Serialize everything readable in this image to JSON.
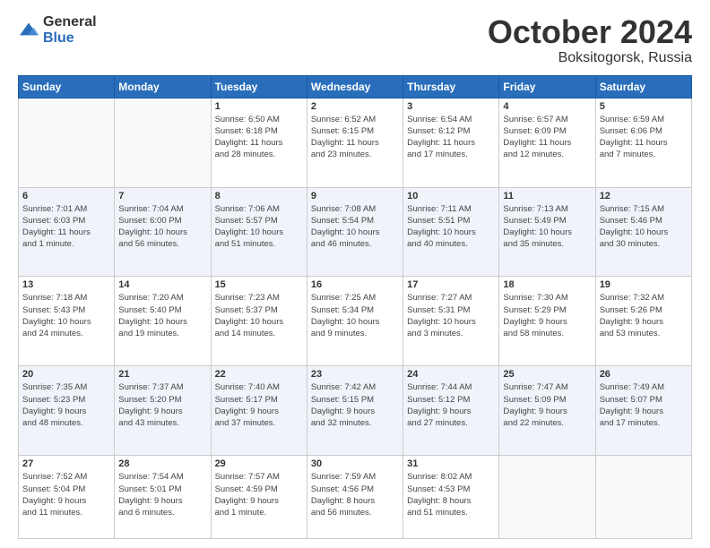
{
  "header": {
    "logo_general": "General",
    "logo_blue": "Blue",
    "month": "October 2024",
    "location": "Boksitogorsk, Russia"
  },
  "weekdays": [
    "Sunday",
    "Monday",
    "Tuesday",
    "Wednesday",
    "Thursday",
    "Friday",
    "Saturday"
  ],
  "weeks": [
    [
      {
        "day": "",
        "info": ""
      },
      {
        "day": "",
        "info": ""
      },
      {
        "day": "1",
        "info": "Sunrise: 6:50 AM\nSunset: 6:18 PM\nDaylight: 11 hours\nand 28 minutes."
      },
      {
        "day": "2",
        "info": "Sunrise: 6:52 AM\nSunset: 6:15 PM\nDaylight: 11 hours\nand 23 minutes."
      },
      {
        "day": "3",
        "info": "Sunrise: 6:54 AM\nSunset: 6:12 PM\nDaylight: 11 hours\nand 17 minutes."
      },
      {
        "day": "4",
        "info": "Sunrise: 6:57 AM\nSunset: 6:09 PM\nDaylight: 11 hours\nand 12 minutes."
      },
      {
        "day": "5",
        "info": "Sunrise: 6:59 AM\nSunset: 6:06 PM\nDaylight: 11 hours\nand 7 minutes."
      }
    ],
    [
      {
        "day": "6",
        "info": "Sunrise: 7:01 AM\nSunset: 6:03 PM\nDaylight: 11 hours\nand 1 minute."
      },
      {
        "day": "7",
        "info": "Sunrise: 7:04 AM\nSunset: 6:00 PM\nDaylight: 10 hours\nand 56 minutes."
      },
      {
        "day": "8",
        "info": "Sunrise: 7:06 AM\nSunset: 5:57 PM\nDaylight: 10 hours\nand 51 minutes."
      },
      {
        "day": "9",
        "info": "Sunrise: 7:08 AM\nSunset: 5:54 PM\nDaylight: 10 hours\nand 46 minutes."
      },
      {
        "day": "10",
        "info": "Sunrise: 7:11 AM\nSunset: 5:51 PM\nDaylight: 10 hours\nand 40 minutes."
      },
      {
        "day": "11",
        "info": "Sunrise: 7:13 AM\nSunset: 5:49 PM\nDaylight: 10 hours\nand 35 minutes."
      },
      {
        "day": "12",
        "info": "Sunrise: 7:15 AM\nSunset: 5:46 PM\nDaylight: 10 hours\nand 30 minutes."
      }
    ],
    [
      {
        "day": "13",
        "info": "Sunrise: 7:18 AM\nSunset: 5:43 PM\nDaylight: 10 hours\nand 24 minutes."
      },
      {
        "day": "14",
        "info": "Sunrise: 7:20 AM\nSunset: 5:40 PM\nDaylight: 10 hours\nand 19 minutes."
      },
      {
        "day": "15",
        "info": "Sunrise: 7:23 AM\nSunset: 5:37 PM\nDaylight: 10 hours\nand 14 minutes."
      },
      {
        "day": "16",
        "info": "Sunrise: 7:25 AM\nSunset: 5:34 PM\nDaylight: 10 hours\nand 9 minutes."
      },
      {
        "day": "17",
        "info": "Sunrise: 7:27 AM\nSunset: 5:31 PM\nDaylight: 10 hours\nand 3 minutes."
      },
      {
        "day": "18",
        "info": "Sunrise: 7:30 AM\nSunset: 5:29 PM\nDaylight: 9 hours\nand 58 minutes."
      },
      {
        "day": "19",
        "info": "Sunrise: 7:32 AM\nSunset: 5:26 PM\nDaylight: 9 hours\nand 53 minutes."
      }
    ],
    [
      {
        "day": "20",
        "info": "Sunrise: 7:35 AM\nSunset: 5:23 PM\nDaylight: 9 hours\nand 48 minutes."
      },
      {
        "day": "21",
        "info": "Sunrise: 7:37 AM\nSunset: 5:20 PM\nDaylight: 9 hours\nand 43 minutes."
      },
      {
        "day": "22",
        "info": "Sunrise: 7:40 AM\nSunset: 5:17 PM\nDaylight: 9 hours\nand 37 minutes."
      },
      {
        "day": "23",
        "info": "Sunrise: 7:42 AM\nSunset: 5:15 PM\nDaylight: 9 hours\nand 32 minutes."
      },
      {
        "day": "24",
        "info": "Sunrise: 7:44 AM\nSunset: 5:12 PM\nDaylight: 9 hours\nand 27 minutes."
      },
      {
        "day": "25",
        "info": "Sunrise: 7:47 AM\nSunset: 5:09 PM\nDaylight: 9 hours\nand 22 minutes."
      },
      {
        "day": "26",
        "info": "Sunrise: 7:49 AM\nSunset: 5:07 PM\nDaylight: 9 hours\nand 17 minutes."
      }
    ],
    [
      {
        "day": "27",
        "info": "Sunrise: 7:52 AM\nSunset: 5:04 PM\nDaylight: 9 hours\nand 11 minutes."
      },
      {
        "day": "28",
        "info": "Sunrise: 7:54 AM\nSunset: 5:01 PM\nDaylight: 9 hours\nand 6 minutes."
      },
      {
        "day": "29",
        "info": "Sunrise: 7:57 AM\nSunset: 4:59 PM\nDaylight: 9 hours\nand 1 minute."
      },
      {
        "day": "30",
        "info": "Sunrise: 7:59 AM\nSunset: 4:56 PM\nDaylight: 8 hours\nand 56 minutes."
      },
      {
        "day": "31",
        "info": "Sunrise: 8:02 AM\nSunset: 4:53 PM\nDaylight: 8 hours\nand 51 minutes."
      },
      {
        "day": "",
        "info": ""
      },
      {
        "day": "",
        "info": ""
      }
    ]
  ]
}
